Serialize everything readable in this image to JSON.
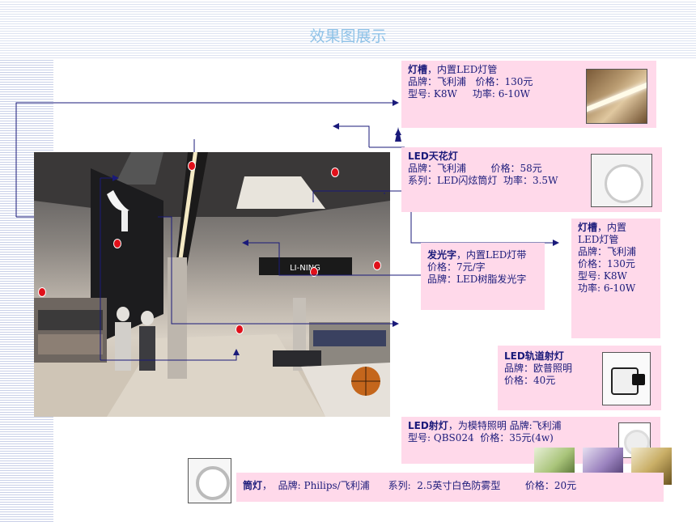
{
  "title": "效果图展示",
  "items": {
    "lightslot1": {
      "name": "灯槽",
      "desc": "，内置LED灯管",
      "line2": "品牌：飞利浦   价格：130元",
      "line3": "型号: K8W     功率: 6-10W"
    },
    "ceiling": {
      "name": "LED天花灯",
      "line2": "品牌：飞利浦        价格：58元",
      "line3": "系列：LED闪炫筒灯  功率：3.5W"
    },
    "lightslot2": {
      "name": "灯槽",
      "desc": "，内置",
      "line2": "LED灯管",
      "line3": "品牌：飞利浦",
      "line4": "价格：130元",
      "line5": "型号: K8W",
      "line6": "功率: 6-10W"
    },
    "sign": {
      "name": "发光字",
      "desc": "，内置LED灯带",
      "line2": "价格：7元/字",
      "line3": "品牌：LED树脂发光字"
    },
    "track": {
      "name": "LED轨道射灯",
      "line2": "品牌：欧普照明",
      "line3": "价格：40元"
    },
    "spot": {
      "name": "LED射灯",
      "desc": "，为模特照明 品牌:飞利浦",
      "line2": "型号: QBS024  价格：35元(4w)"
    },
    "downlight": {
      "name": "筒灯",
      "desc": "，  品牌: Philips/飞利浦      系列:  2.5英寸白色防雾型        价格：20元"
    }
  },
  "photo_sign_text": "LI-NING"
}
